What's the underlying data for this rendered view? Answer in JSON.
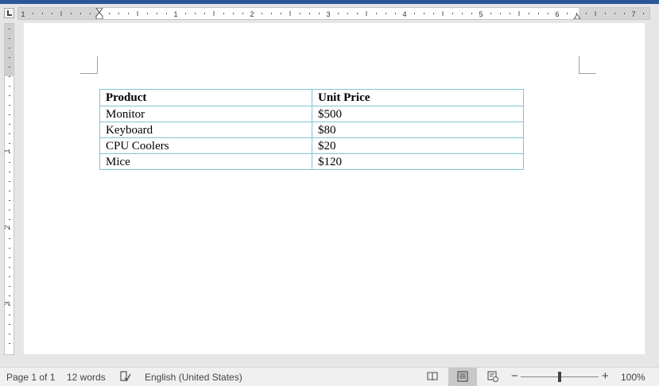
{
  "ruler": {
    "numbers": [
      "1",
      "1",
      "2",
      "3",
      "4",
      "5",
      "6",
      "7"
    ]
  },
  "vruler": {
    "numbers": [
      "1",
      "2",
      "3"
    ]
  },
  "table": {
    "headers": [
      "Product",
      "Unit Price"
    ],
    "rows": [
      [
        "Monitor",
        "$500"
      ],
      [
        "Keyboard",
        "$80"
      ],
      [
        "CPU Coolers",
        "$20"
      ],
      [
        "Mice",
        "$120"
      ]
    ]
  },
  "status": {
    "page": "Page 1 of 1",
    "words": "12 words",
    "language": "English (United States)",
    "zoom": "100%",
    "zoom_minus": "−",
    "zoom_plus": "+"
  },
  "colors": {
    "accent": "#2b579a",
    "table_border": "#7fc4d6"
  },
  "icons": [
    "tab-selector-icon",
    "proofing-icon",
    "read-mode-icon",
    "print-layout-icon",
    "web-layout-icon"
  ]
}
